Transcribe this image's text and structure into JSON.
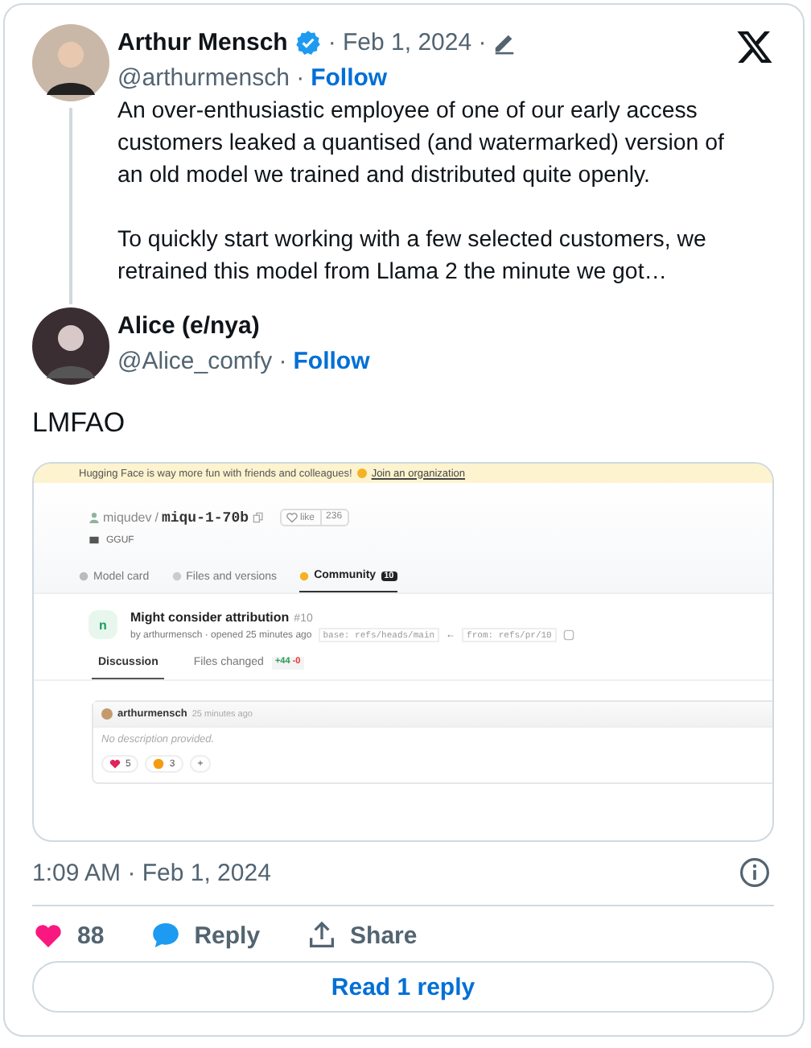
{
  "thread": [
    {
      "name": "Arthur Mensch",
      "verified": true,
      "date": "· Feb 1, 2024 ·",
      "handle": "@arthurmensch ·",
      "follow": "Follow",
      "paragraphs": [
        "An over-enthusiastic employee of one of our early access customers leaked a quantised (and watermarked) version of an old model we trained and distributed quite openly.",
        "To quickly start working with a few selected customers, we retrained this model from Llama 2 the minute we got…"
      ]
    },
    {
      "name": "Alice (e/nya)",
      "verified": false,
      "handle": "@Alice_comfy ·",
      "follow": "Follow"
    }
  ],
  "tweet_text": "LMFAO",
  "attached_screenshot": {
    "banner": {
      "text": "Hugging Face is way more fun with friends and colleagues!",
      "link": "Join an organization"
    },
    "repo": {
      "owner": "miqudev",
      "separator": "/",
      "name": "miqu-1-70b",
      "like_label": "like",
      "like_count": "236"
    },
    "tag": "GGUF",
    "tabs": [
      {
        "label": "Model card",
        "selected": false
      },
      {
        "label": "Files and versions",
        "selected": false
      },
      {
        "label": "Community",
        "count": "10",
        "selected": true
      }
    ],
    "pull_request": {
      "badge": "n",
      "title": "Might consider attribution",
      "number": "#10",
      "byline": "by arthurmensch · opened 25 minutes ago",
      "base": "base: refs/heads/main",
      "arrow": "←",
      "from": "from: refs/pr/10"
    },
    "subtabs": [
      {
        "label": "Discussion",
        "selected": true
      },
      {
        "label": "Files changed",
        "added": "+44",
        "removed": "-0",
        "selected": false
      }
    ],
    "comment": {
      "author": "arthurmensch",
      "time": "25 minutes ago",
      "body": "No description provided.",
      "reactions": [
        {
          "kind": "heart",
          "count": "5"
        },
        {
          "kind": "hug",
          "count": "3"
        }
      ],
      "add": "+"
    }
  },
  "timestamp": "1:09 AM · Feb 1, 2024",
  "actions": [
    {
      "kind": "like",
      "label": "88"
    },
    {
      "kind": "reply",
      "label": "Reply"
    },
    {
      "kind": "share",
      "label": "Share"
    }
  ],
  "read_replies": "Read 1 reply"
}
